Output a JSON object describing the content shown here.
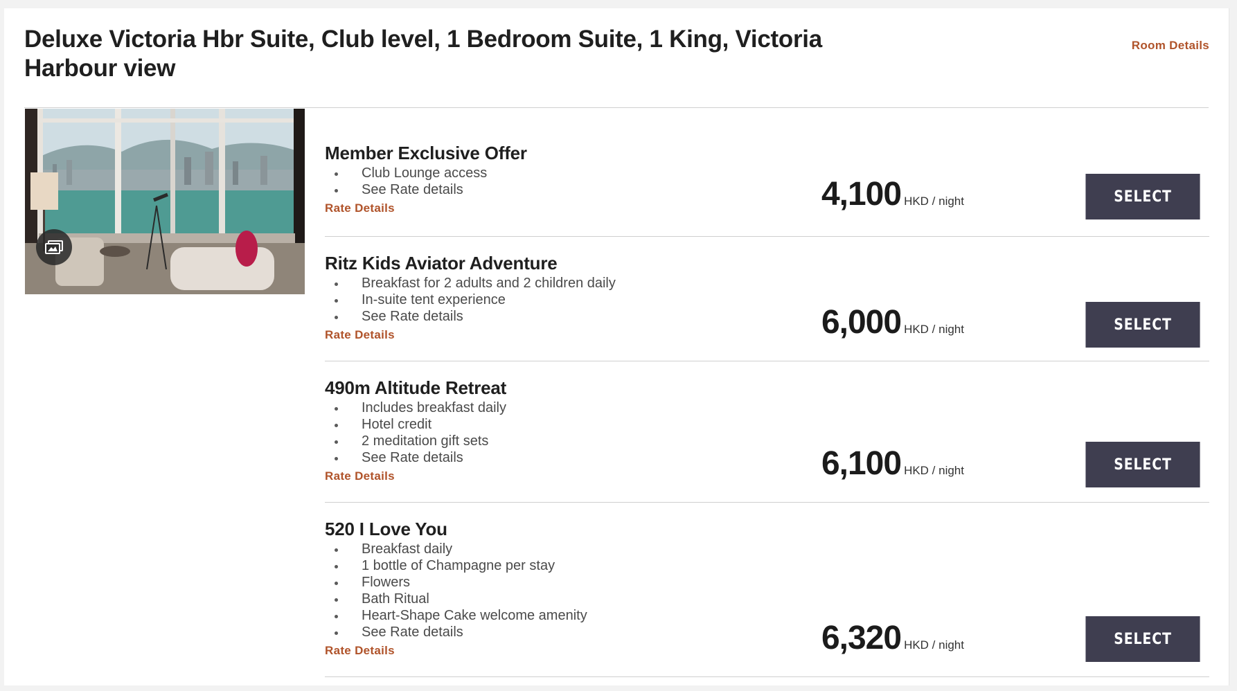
{
  "room": {
    "title": "Deluxe Victoria Hbr Suite, Club level, 1 Bedroom Suite, 1 King, Victoria Harbour view",
    "room_details_label": "Room Details",
    "gallery_icon": "gallery-icon"
  },
  "rates": [
    {
      "name": "Member Exclusive Offer",
      "features": [
        "Club Lounge access",
        "See Rate details"
      ],
      "rate_details_label": "Rate Details",
      "price": "4,100",
      "unit": "HKD / night",
      "select_label": "SELECT"
    },
    {
      "name": "Ritz Kids Aviator Adventure",
      "features": [
        "Breakfast for 2 adults and 2 children daily",
        "In-suite tent experience",
        "See Rate details"
      ],
      "rate_details_label": "Rate Details",
      "price": "6,000",
      "unit": "HKD / night",
      "select_label": "SELECT"
    },
    {
      "name": "490m Altitude Retreat",
      "features": [
        "Includes breakfast daily",
        "Hotel credit",
        "2 meditation gift sets",
        "See Rate details"
      ],
      "rate_details_label": "Rate Details",
      "price": "6,100",
      "unit": "HKD / night",
      "select_label": "SELECT"
    },
    {
      "name": "520 I Love You",
      "features": [
        "Breakfast daily",
        "1 bottle of Champagne per stay",
        "Flowers",
        "Bath Ritual",
        "Heart-Shape Cake welcome amenity",
        "See Rate details"
      ],
      "rate_details_label": "Rate Details",
      "price": "6,320",
      "unit": "HKD / night",
      "select_label": "SELECT"
    }
  ],
  "colors": {
    "accent_link": "#b0532a",
    "button_bg": "#3f3e50"
  }
}
